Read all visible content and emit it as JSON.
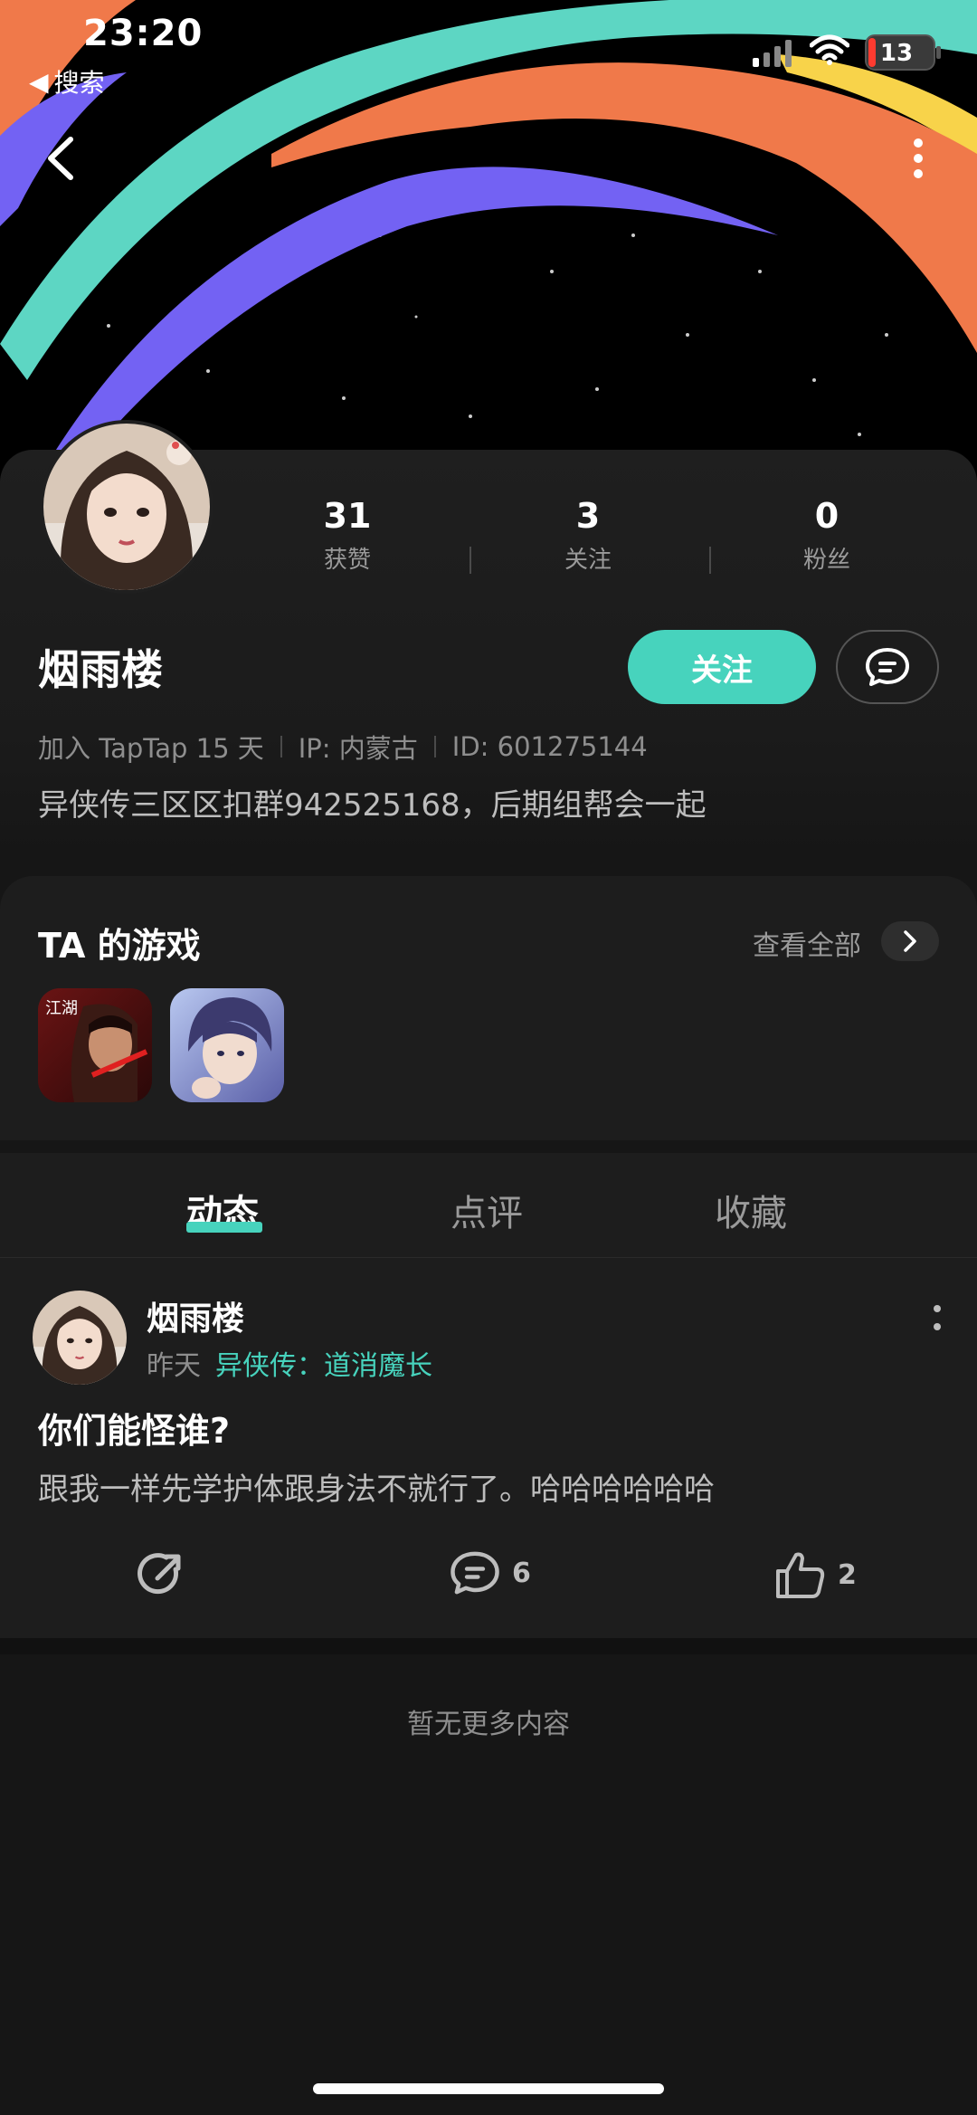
{
  "status_bar": {
    "time": "23:20",
    "back_label": "搜索",
    "battery": "13"
  },
  "profile": {
    "username": "烟雨楼",
    "stats": [
      {
        "value": "31",
        "label": "获赞"
      },
      {
        "value": "3",
        "label": "关注"
      },
      {
        "value": "0",
        "label": "粉丝"
      }
    ],
    "follow_label": "关注",
    "joined": "加入 TapTap 15 天",
    "ip": "IP: 内蒙古",
    "id": "ID: 601275144",
    "bio": "异侠传三区区扣群942525168，后期组帮会一起"
  },
  "games": {
    "title": "TA 的游戏",
    "see_all": "查看全部",
    "icon_text": "江湖"
  },
  "tabs": [
    "动态",
    "点评",
    "收藏"
  ],
  "post": {
    "author": "烟雨楼",
    "time": "昨天",
    "game": "异侠传：道消魔长",
    "title": "你们能怪谁?",
    "body": "跟我一样先学护体跟身法不就行了。哈哈哈哈哈哈",
    "comments": "6",
    "likes": "2"
  },
  "footer": {
    "no_more": "暂无更多内容"
  },
  "colors": {
    "accent": "#47d3bd",
    "background": "#161616",
    "card": "#1d1d1d"
  }
}
